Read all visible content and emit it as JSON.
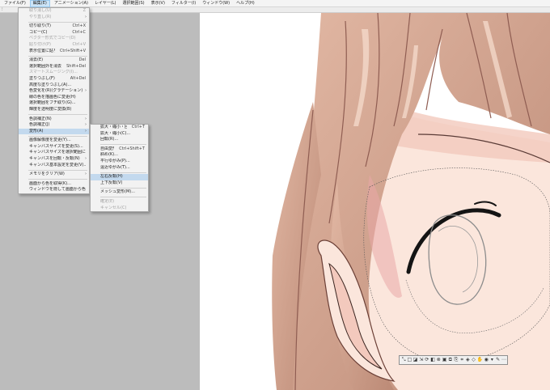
{
  "menubar": [
    {
      "label": "ファイル(F)",
      "active": false
    },
    {
      "label": "編集(E)",
      "active": true
    },
    {
      "label": "アニメーション(A)",
      "active": false
    },
    {
      "label": "レイヤー(L)",
      "active": false
    },
    {
      "label": "選択範囲(S)",
      "active": false
    },
    {
      "label": "表示(V)",
      "active": false
    },
    {
      "label": "フィルター(I)",
      "active": false
    },
    {
      "label": "ウィンドウ(W)",
      "active": false
    },
    {
      "label": "ヘルプ(H)",
      "active": false
    }
  ],
  "edit_menu": {
    "items": [
      {
        "label": "取り消し(U)",
        "shortcut": "Z",
        "disabled": true
      },
      {
        "label": "やり直し(R)",
        "shortcut": "",
        "disabled": true,
        "submenu": true
      },
      {
        "sep": true
      },
      {
        "label": "切り取り(T)",
        "shortcut": "Ctrl+X",
        "disabled": false
      },
      {
        "label": "コピー(C)",
        "shortcut": "Ctrl+C",
        "disabled": false
      },
      {
        "label": "ベクター形式でコピー(D)",
        "shortcut": "",
        "disabled": true
      },
      {
        "label": "貼り付け(P)",
        "shortcut": "Ctrl+V",
        "disabled": true
      },
      {
        "label": "表示位置に貼り付け(E)",
        "shortcut": "Ctrl+Shift+V",
        "disabled": false
      },
      {
        "sep": true
      },
      {
        "label": "消去(E)",
        "shortcut": "Del",
        "disabled": false
      },
      {
        "label": "選択範囲外を消去(O)",
        "shortcut": "Shift+Del",
        "disabled": false
      },
      {
        "label": "スマートスムージング(I)...",
        "shortcut": "",
        "disabled": true
      },
      {
        "label": "塗りつぶし(F)",
        "shortcut": "Alt+Del",
        "disabled": false
      },
      {
        "label": "高度な塗りつぶし(A)...",
        "shortcut": "",
        "disabled": false
      },
      {
        "label": "色変化を(R)(グラデーション)",
        "shortcut": "",
        "disabled": false,
        "submenu": true
      },
      {
        "label": "線の色を描画色に変更(H)",
        "shortcut": "",
        "disabled": false
      },
      {
        "label": "選択範囲をフチ取り(G)...",
        "shortcut": "",
        "disabled": false
      },
      {
        "label": "輝度を透明度に変換(B)",
        "shortcut": "",
        "disabled": false
      },
      {
        "sep": true
      },
      {
        "label": "色調補正(N)",
        "shortcut": "",
        "disabled": false,
        "submenu": true
      },
      {
        "label": "色調補正(J)",
        "shortcut": "",
        "disabled": false,
        "submenu": true
      },
      {
        "label": "変形(A)",
        "shortcut": "",
        "disabled": false,
        "submenu": true,
        "highlight": true
      },
      {
        "sep": true
      },
      {
        "label": "画像解像度を変更(Y)...",
        "shortcut": "",
        "disabled": false
      },
      {
        "label": "キャンバスサイズを変更(S)...",
        "shortcut": "",
        "disabled": false
      },
      {
        "label": "キャンバスサイズを選択範囲に合わせる(Z)",
        "shortcut": "",
        "disabled": false
      },
      {
        "label": "キャンバスを回転・反転(N)",
        "shortcut": "",
        "disabled": false,
        "submenu": true
      },
      {
        "label": "キャンバス基本設定を変更(V)...",
        "shortcut": "",
        "disabled": false
      },
      {
        "sep": true
      },
      {
        "label": "メモリをクリア(W)",
        "shortcut": "",
        "disabled": false,
        "submenu": true
      },
      {
        "sep": true
      },
      {
        "label": "画面から色を取得(K)...",
        "shortcut": "",
        "disabled": false
      },
      {
        "label": "ウィンドウを隠して画面から色を取得(H)...",
        "shortcut": "",
        "disabled": false
      }
    ]
  },
  "transform_menu": {
    "items": [
      {
        "label": "拡大・縮小・回転(S)...",
        "shortcut": "Ctrl+T",
        "disabled": false
      },
      {
        "label": "拡大・縮小(C)...",
        "shortcut": "",
        "disabled": false
      },
      {
        "label": "回転(R)...",
        "shortcut": "",
        "disabled": false
      },
      {
        "sep": true
      },
      {
        "label": "自由変形(D)...",
        "shortcut": "Ctrl+Shift+T",
        "disabled": false
      },
      {
        "label": "斜め(K)...",
        "shortcut": "",
        "disabled": false
      },
      {
        "label": "平行ゆがみ(P)...",
        "shortcut": "",
        "disabled": false
      },
      {
        "label": "遠近ゆがみ(T)...",
        "shortcut": "",
        "disabled": false
      },
      {
        "sep": true
      },
      {
        "label": "左右反転(H)",
        "shortcut": "",
        "disabled": false,
        "highlight": true
      },
      {
        "label": "上下反転(V)",
        "shortcut": "",
        "disabled": false
      },
      {
        "sep": true
      },
      {
        "label": "メッシュ変形(M)...",
        "shortcut": "",
        "disabled": false
      },
      {
        "sep": true
      },
      {
        "label": "確定(E)",
        "shortcut": "",
        "disabled": true
      },
      {
        "label": "キャンセル(C)",
        "shortcut": "",
        "disabled": true
      }
    ]
  },
  "float_toolbar": {
    "buttons": [
      {
        "name": "select-rect-icon",
        "glyph": "⤡"
      },
      {
        "name": "deselect-icon",
        "glyph": "□"
      },
      {
        "name": "invert-selection-icon",
        "glyph": "◪"
      },
      {
        "name": "scale-icon",
        "glyph": "⇲"
      },
      {
        "name": "rotate-icon",
        "glyph": "⟳"
      },
      {
        "name": "flip-icon",
        "glyph": "◧"
      },
      {
        "name": "clear-icon",
        "glyph": "⊗"
      },
      {
        "name": "fill-icon",
        "glyph": "▣"
      },
      {
        "name": "copy-icon",
        "glyph": "⧉"
      },
      {
        "name": "paste-icon",
        "glyph": "⎘"
      },
      {
        "name": "crop-icon",
        "glyph": "⌗"
      },
      {
        "name": "grow-icon",
        "glyph": "◈"
      },
      {
        "name": "shrink-icon",
        "glyph": "◇"
      },
      {
        "name": "hand-icon",
        "glyph": "✋"
      },
      {
        "name": "mask-icon",
        "glyph": "◉"
      },
      {
        "name": "settings-icon",
        "glyph": "▾"
      },
      {
        "name": "brush-icon",
        "glyph": "✎"
      },
      {
        "name": "more-icon",
        "glyph": "⋯"
      }
    ]
  },
  "colors": {
    "hair_base": "#bc8a76",
    "hair_dark": "#8f5d52",
    "hair_light": "#e2b8a4",
    "skin": "#fbe6dc",
    "skin_shadow": "#f3c9bd",
    "lash": "#141414",
    "highlight": "#c3d9ee"
  }
}
